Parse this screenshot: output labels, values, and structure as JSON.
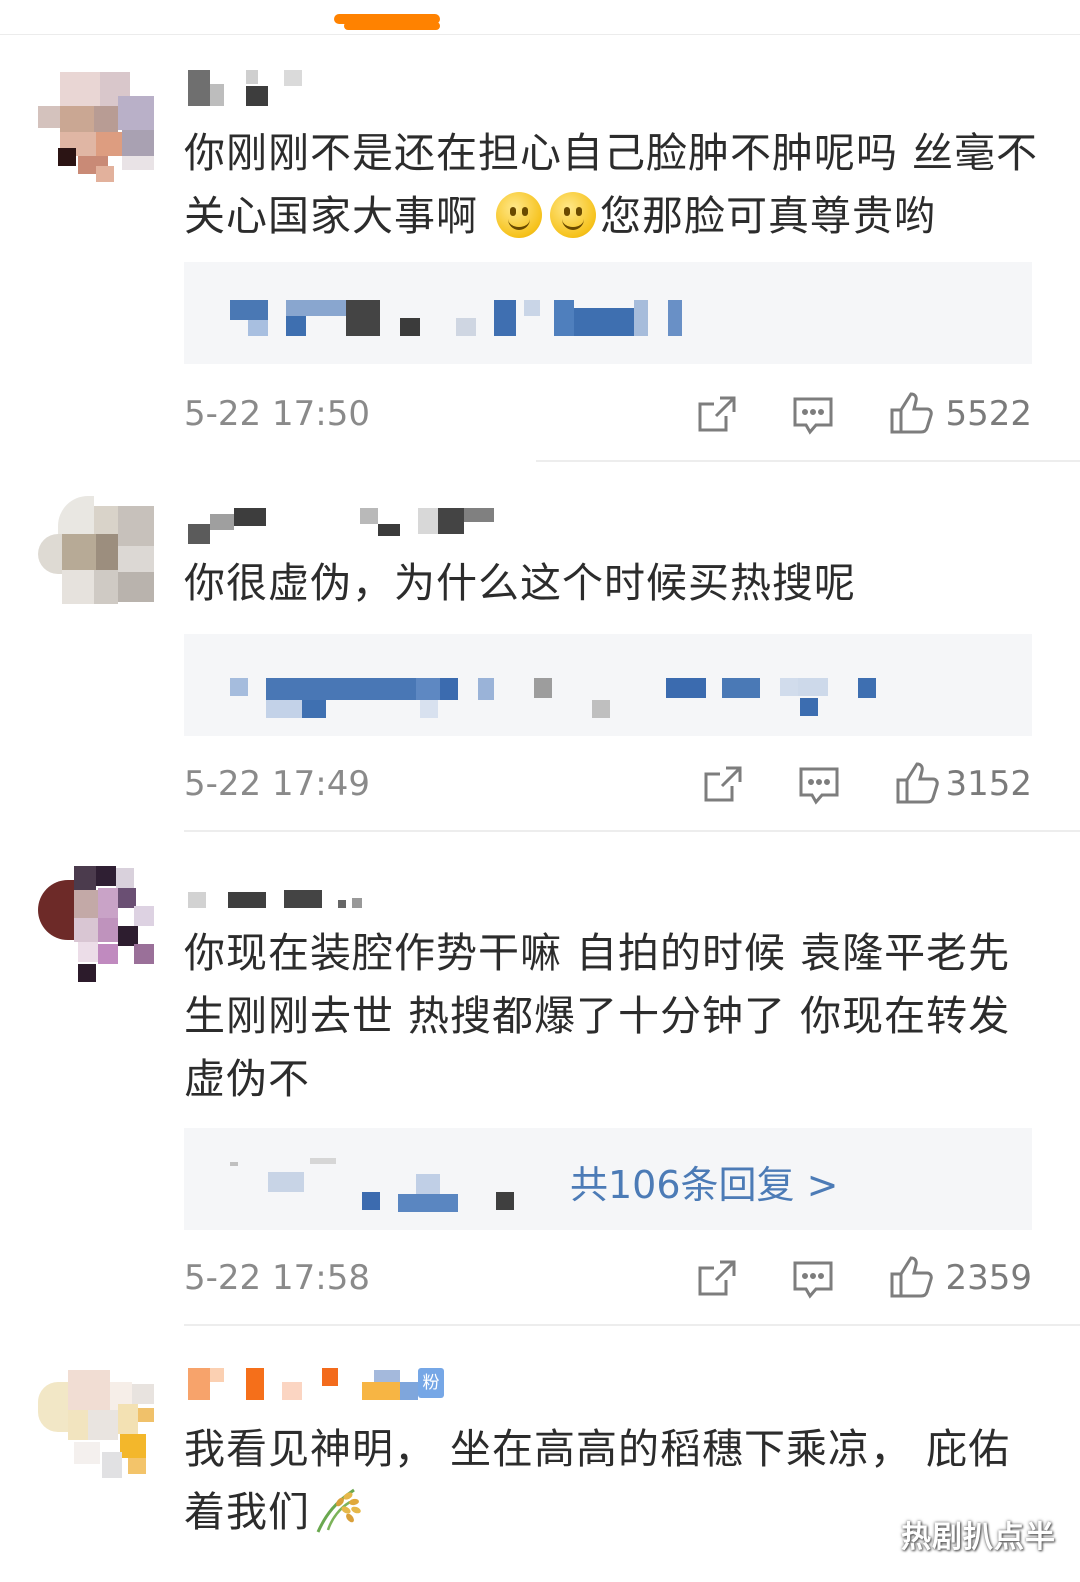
{
  "comments": [
    {
      "text_parts": [
        "你刚刚不是还在担心自己脸肿不肿呢吗 丝毫不关心国家大事啊",
        "您那脸可真尊贵哟"
      ],
      "emojis": [
        "smile-emoji",
        "smile-emoji"
      ],
      "time": "5-22 17:50",
      "likes": "5522"
    },
    {
      "text": "你很虚伪，为什么这个时候买热搜呢",
      "time": "5-22 17:49",
      "likes": "3152"
    },
    {
      "text": "你现在装腔作势干嘛 自拍的时候 袁隆平老先生刚刚去世 热搜都爆了十分钟了 你现在转发 虚伪不",
      "reply_count": "共106条回复 >",
      "time": "5-22 17:58",
      "likes": "2359"
    },
    {
      "text": "我看见神明， 坐在高高的稻穗下乘凉， 庇佑着我们",
      "badge": "粉",
      "trailing_icon": "rice-icon"
    }
  ],
  "watermark": "热剧扒点半",
  "colors": {
    "accent": "#ff8200",
    "link": "#4c7bb6",
    "meta": "#8a8a8a",
    "reply_bg": "#f5f6f8"
  },
  "icons": [
    "share-icon",
    "comment-icon",
    "like-icon",
    "smile-emoji",
    "rice-icon"
  ]
}
